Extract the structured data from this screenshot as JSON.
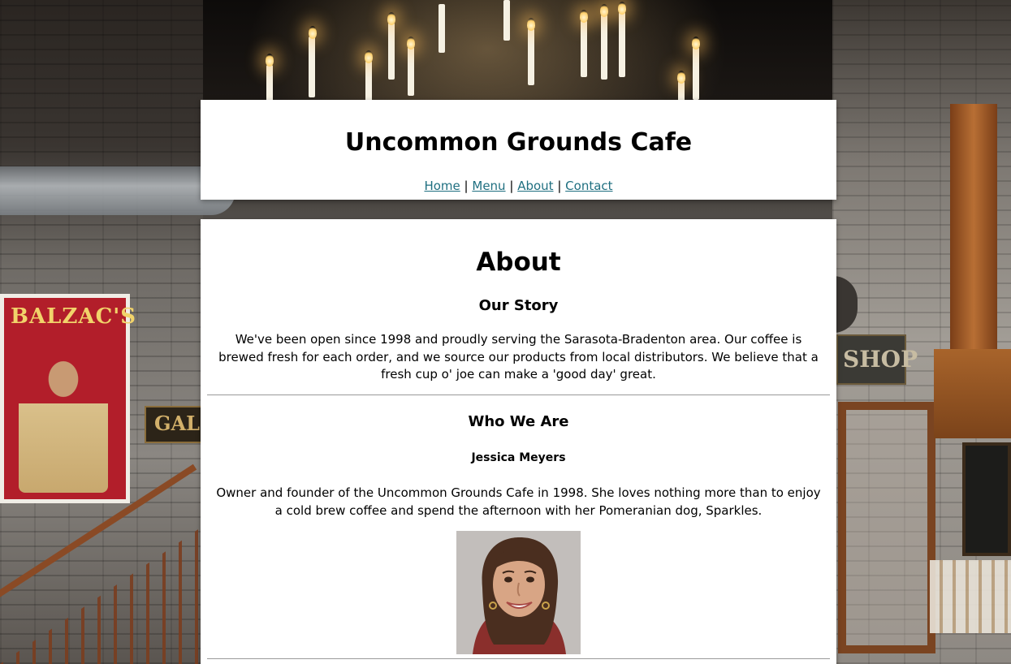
{
  "site": {
    "title": "Uncommon Grounds Cafe"
  },
  "nav": {
    "items": [
      {
        "label": "Home"
      },
      {
        "label": "Menu"
      },
      {
        "label": "About"
      },
      {
        "label": "Contact"
      }
    ],
    "separator": "|",
    "link_color": "#1f6f80"
  },
  "background": {
    "poster_text": "BALZAC'S",
    "sign_text": "GAL",
    "shop_sign_text": "SHOP"
  },
  "main": {
    "heading": "About",
    "our_story": {
      "title": "Our Story",
      "text": "We've been open since 1998 and proudly serving the Sarasota-Bradenton area. Our coffee is brewed fresh for each order, and we source our products from local distributors. We believe that a fresh cup o' joe can make a 'good day' great."
    },
    "who_we_are": {
      "title": "Who We Are",
      "person": {
        "name": "Jessica Meyers",
        "bio": "Owner and founder of the Uncommon Grounds Cafe in 1998. She loves nothing more than to enjoy a cold brew coffee and spend the afternoon with her Pomeranian dog, Sparkles.",
        "photo_icon": "person-portrait"
      }
    }
  }
}
